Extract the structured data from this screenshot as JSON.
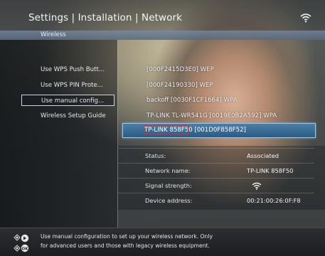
{
  "header": {
    "title": "Settings | Installation | Network",
    "subtitle": "Wireless"
  },
  "left_menu": {
    "items": [
      {
        "label": "Use WPS Push Butt..."
      },
      {
        "label": "Use WPS PIN Prote..."
      },
      {
        "label": "Use manual config...",
        "selected": true
      },
      {
        "label": "Wireless Setup Guide"
      }
    ]
  },
  "networks": {
    "items": [
      {
        "label": "[000F2415D3E0] WEP"
      },
      {
        "label": "[000F24190330] WEP"
      },
      {
        "label": "backoff [0030F1CF1664] WPA"
      },
      {
        "label": "TP-LINK TL-WR541G [0019E0B2A592] WPA"
      },
      {
        "label": "TP-LINK 858F50 [001D0F858F52]",
        "selected": true
      }
    ]
  },
  "details": {
    "status_label": "Status:",
    "status_value": "Associated",
    "name_label": "Network name:",
    "name_value": "TP-LINK 858F50",
    "signal_label": "Signal strength:",
    "address_label": "Device address:",
    "address_value": "00:21:00:26:0F:F8"
  },
  "footer": {
    "line1": "Use manual configuration to set up your wireless network. Only",
    "line2": "for advanced users and those with legacy wireless equipment."
  },
  "icons": {
    "wifi_header": "wifi-icon",
    "signal": "wifi-signal-icon",
    "footer_nav": "remote-nav-icon",
    "footer_ok": "remote-ok-icon"
  }
}
